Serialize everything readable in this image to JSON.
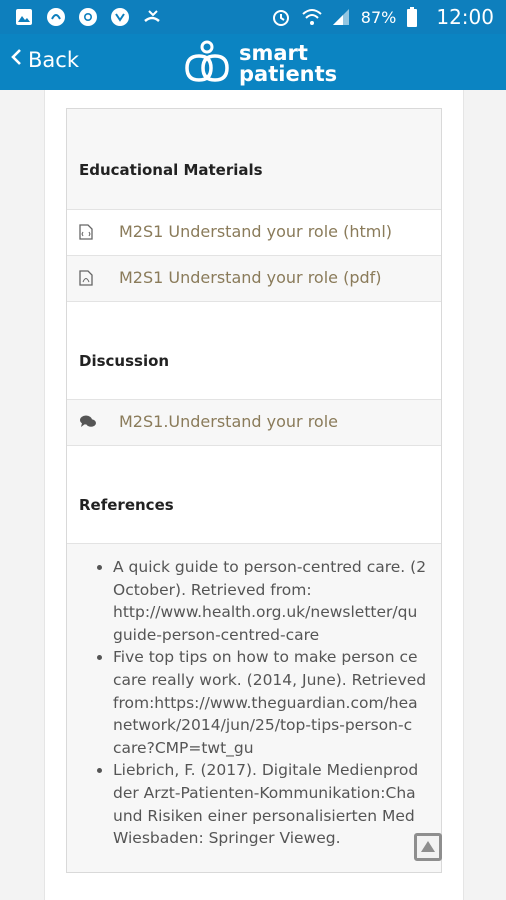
{
  "status_bar": {
    "battery": "87%",
    "time": "12:00",
    "icons": [
      "gallery-icon",
      "app-icon",
      "chrome-icon",
      "app-icon",
      "missed-call-icon",
      "alarm-icon",
      "wifi-icon",
      "signal-icon",
      "battery-icon"
    ]
  },
  "app_bar": {
    "back_label": "Back",
    "logo_line1": "smart",
    "logo_line2": "patients"
  },
  "sections": {
    "educational": {
      "title": "Educational Materials",
      "items": [
        {
          "label": "M2S1 Understand your role (html)",
          "icon": "html-file-icon"
        },
        {
          "label": "M2S1 Understand your role (pdf)",
          "icon": "pdf-file-icon"
        }
      ]
    },
    "discussion": {
      "title": "Discussion",
      "items": [
        {
          "label": "M2S1.Understand your role",
          "icon": "chat-bubbles-icon"
        }
      ]
    },
    "references": {
      "title": "References",
      "items": [
        {
          "lines": [
            "A quick guide to person-centred care. (2",
            "October). Retrieved from:",
            "http://www.health.org.uk/newsletter/qu",
            "guide-person-centred-care"
          ]
        },
        {
          "lines": [
            "Five top tips on how to make person ce",
            "care really work. (2014, June). Retrieved",
            "from:https://www.theguardian.com/hea",
            "network/2014/jun/25/top-tips-person-c",
            "care?CMP=twt_gu"
          ]
        },
        {
          "lines": [
            "Liebrich, F. (2017). Digitale Medienprod",
            "der Arzt-Patienten-Kommunikation:Cha",
            "und Risiken einer personalisierten Med",
            "Wiesbaden: Springer Vieweg."
          ]
        }
      ]
    }
  },
  "colors": {
    "status_bar": "#0e7fbd",
    "app_bar": "#0b84c2",
    "link_text": "#8a7b5a"
  }
}
